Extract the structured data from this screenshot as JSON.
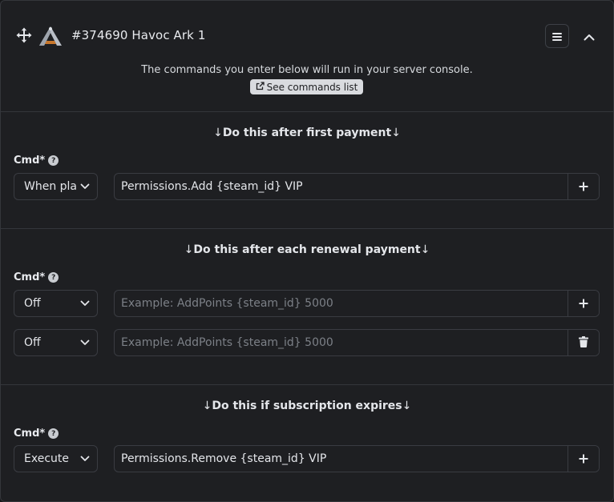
{
  "header": {
    "title": "#374690 Havoc Ark 1",
    "icons": {
      "move": "move-icon",
      "logo": "ark-logo-icon",
      "menu": "hamburger-menu-icon",
      "collapse": "chevron-up-icon"
    }
  },
  "info": {
    "text": "The commands you enter below will run in your server console.",
    "link_label": "See commands list",
    "link_icon": "external-link-icon"
  },
  "sections": [
    {
      "heading": "Do this after first payment",
      "cmd_label": "Cmd*",
      "rows": [
        {
          "select": "When pla",
          "value": "Permissions.Add {steam_id} VIP",
          "placeholder": "",
          "action_icon": "plus-icon"
        }
      ]
    },
    {
      "heading": "Do this after each renewal payment",
      "cmd_label": "Cmd*",
      "rows": [
        {
          "select": "Off",
          "value": "",
          "placeholder": "Example: AddPoints {steam_id} 5000",
          "action_icon": "plus-icon"
        },
        {
          "select": "Off",
          "value": "",
          "placeholder": "Example: AddPoints {steam_id} 5000",
          "action_icon": "trash-icon"
        }
      ]
    },
    {
      "heading": "Do this if subscription expires",
      "cmd_label": "Cmd*",
      "rows": [
        {
          "select": "Execute",
          "value": "Permissions.Remove {steam_id} VIP",
          "placeholder": "",
          "action_icon": "plus-icon"
        }
      ]
    }
  ],
  "arrow_glyph": "↓",
  "help_glyph": "?",
  "colors": {
    "panel": "#1e1f22",
    "border": "#34363b",
    "text": "#e4e6ea",
    "link_bg": "#d9dbdf"
  }
}
